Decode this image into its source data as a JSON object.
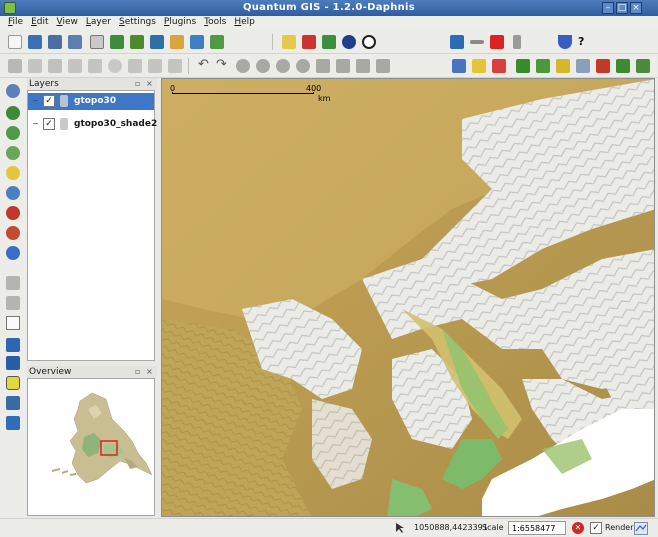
{
  "window": {
    "title": "Quantum GIS - 1.2.0-Daphnis"
  },
  "menu": [
    "File",
    "Edit",
    "View",
    "Layer",
    "Settings",
    "Plugins",
    "Tools",
    "Help"
  ],
  "panels": {
    "layers": {
      "title": "Layers",
      "items": [
        {
          "name": "gtopo30",
          "checked": "✓",
          "expander": "−",
          "selected": true
        },
        {
          "name": "gtopo30_shade2",
          "checked": "✓",
          "expander": "−",
          "selected": false
        }
      ]
    },
    "overview": {
      "title": "Overview"
    }
  },
  "map": {
    "scalebar": {
      "start": "0",
      "end": "400",
      "unit": "km"
    }
  },
  "statusbar": {
    "coordinates": "1050888,4423391",
    "scale_label": "Scale",
    "scale_value": "1:6558477",
    "render_label": "Render",
    "render_checked": "✓",
    "stop_symbol": "✕"
  },
  "icons": {
    "file_toolbar": [
      "new-project-icon",
      "open-project-icon",
      "save-project-icon",
      "save-as-icon",
      "print-icon",
      "add-layer-icons"
    ],
    "navigation": [
      "pan-icon",
      "zoom-in-icon",
      "zoom-out-icon",
      "zoom-full-icon",
      "zoom-layer-icon",
      "zoom-selection-icon",
      "zoom-last-icon",
      "refresh-icon"
    ],
    "colors": {
      "selection": "#3e76c8",
      "titlebar": "#2f5d9c",
      "stop": "#d12626"
    }
  }
}
